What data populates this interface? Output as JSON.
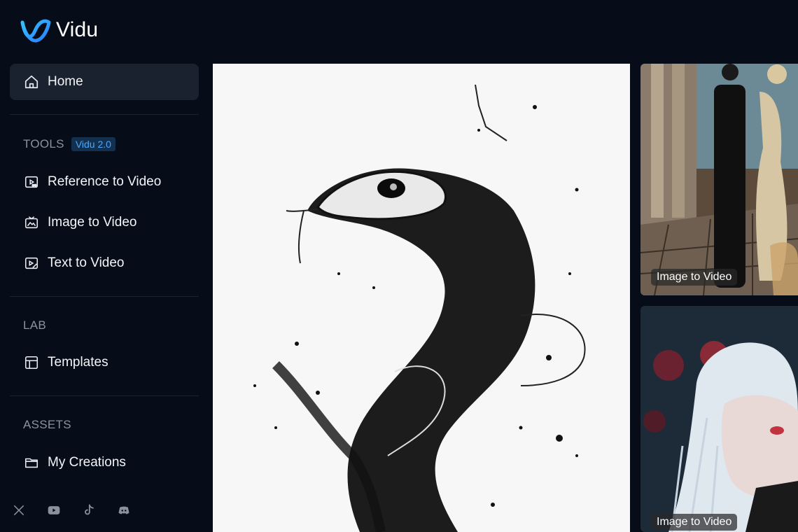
{
  "app": {
    "name": "Vidu",
    "accent_color": "#3aa0ff"
  },
  "sidebar": {
    "home": {
      "label": "Home",
      "icon": "home-icon"
    },
    "tools": {
      "title": "TOOLS",
      "badge": "Vidu 2.0",
      "items": [
        {
          "label": "Reference to Video",
          "icon": "reference-video-icon"
        },
        {
          "label": "Image to Video",
          "icon": "image-video-icon"
        },
        {
          "label": "Text to Video",
          "icon": "text-video-icon"
        }
      ]
    },
    "lab": {
      "title": "LAB",
      "items": [
        {
          "label": "Templates",
          "icon": "templates-icon"
        }
      ]
    },
    "assets": {
      "title": "ASSETS",
      "items": [
        {
          "label": "My Creations",
          "icon": "folder-icon"
        }
      ]
    },
    "socials": [
      "x-icon",
      "youtube-icon",
      "tiktok-icon",
      "discord-icon"
    ]
  },
  "gallery": {
    "cards": [
      {
        "tag": ""
      },
      {
        "tag": "Image to Video"
      },
      {
        "tag": "Image to Video"
      }
    ]
  }
}
